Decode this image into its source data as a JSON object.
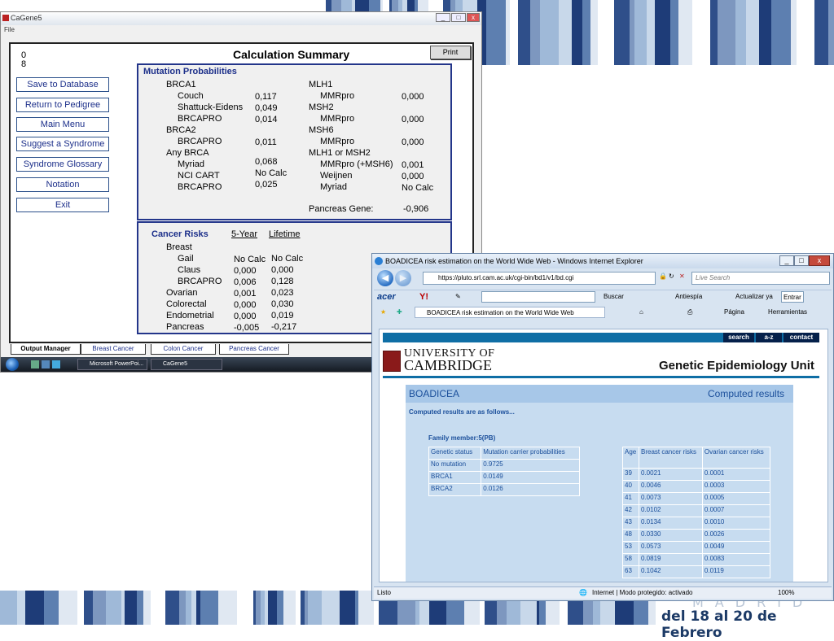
{
  "cagene": {
    "title": "CaGene5",
    "menu_file": "File",
    "code_top": "0",
    "code_bottom": "8",
    "calc_title": "Calculation Summary",
    "print_label": "Print",
    "side_buttons": [
      "Save to Database",
      "Return to Pedigree",
      "Main Menu",
      "Suggest a Syndrome",
      "Syndrome Glossary",
      "Notation",
      "Exit"
    ],
    "mutation": {
      "header": "Mutation Probabilities",
      "brca1": "BRCA1",
      "couch": "Couch",
      "couch_v": "0,117",
      "shattuck": "Shattuck-Eidens",
      "shattuck_v": "0,049",
      "brcapro1": "BRCAPRO",
      "brcapro1_v": "0,014",
      "brca2": "BRCA2",
      "brcapro2": "BRCAPRO",
      "brcapro2_v": "0,011",
      "anybrca": "Any BRCA",
      "myriad": "Myriad",
      "myriad_v": "0,068",
      "ncicart": "NCI CART",
      "ncicart_v": "No Calc",
      "brcapro3": "BRCAPRO",
      "brcapro3_v": "0,025",
      "mlh1": "MLH1",
      "mmr1": "MMRpro",
      "mmr1_v": "0,000",
      "msh2": "MSH2",
      "mmr2": "MMRpro",
      "mmr2_v": "0,000",
      "msh6": "MSH6",
      "mmr3": "MMRpro",
      "mmr3_v": "0,000",
      "mlh1msh2": "MLH1 or MSH2",
      "mmr4": "MMRpro (+MSH6)",
      "mmr4_v": "0,001",
      "weijnen": "Weijnen",
      "weijnen_v": "0,000",
      "myriad2": "Myriad",
      "myriad2_v": "No Calc",
      "pancreas_gene": "Pancreas Gene:",
      "pancreas_gene_v": "-0,906"
    },
    "cancer": {
      "header": "Cancer Risks",
      "col5": "5-Year",
      "collife": "Lifetime",
      "breast": "Breast",
      "rows": [
        {
          "label": "Gail",
          "v5": "No Calc",
          "vl": "No Calc"
        },
        {
          "label": "Claus",
          "v5": "0,000",
          "vl": "0,000"
        },
        {
          "label": "BRCAPRO",
          "v5": "0,006",
          "vl": "0,128"
        },
        {
          "label": "Ovarian",
          "v5": "0,001",
          "vl": "0,023"
        },
        {
          "label": "Colorectal",
          "v5": "0,000",
          "vl": "0,030"
        },
        {
          "label": "Endometrial",
          "v5": "0,000",
          "vl": "0,019"
        },
        {
          "label": "Pancreas",
          "v5": "-0,005",
          "vl": "-0,217"
        }
      ]
    },
    "tabs": [
      "Output Manager",
      "Breast Cancer",
      "Colon Cancer",
      "Pancreas Cancer"
    ],
    "taskbar": {
      "ppt": "Microsoft PowerPoi...",
      "cagene": "CaGene5"
    }
  },
  "ie": {
    "title": "BOADICEA risk estimation on the World Wide Web - Windows Internet Explorer",
    "url": "https://pluto.srl.cam.ac.uk/cgi-bin/bd1/v1/bd.cgi",
    "search_placeholder": "Live Search",
    "toolbar": {
      "acer": "acer",
      "yahoo": "Y!",
      "buscar": "Buscar",
      "antiespia": "Antiespía",
      "actualizar": "Actualizar ya",
      "entrar": "Entrar"
    },
    "tab_label": "BOADICEA risk estimation on the World Wide Web",
    "cmd": {
      "pagina": "Página",
      "herramientas": "Herramientas"
    },
    "nav": {
      "search": "search",
      "az": "a-z",
      "contact": "contact"
    },
    "uni_line1": "UNIVERSITY OF",
    "uni_line2": "CAMBRIDGE",
    "unit": "Genetic Epidemiology Unit",
    "boadicea": "BOADICEA",
    "computed": "Computed results",
    "intro": "Computed results are as follows...",
    "family": "Family member:5(PB)",
    "mut_table": {
      "headers": [
        "Genetic status",
        "Mutation carrier probabilities"
      ],
      "rows": [
        [
          "No mutation",
          "0.9725"
        ],
        [
          "BRCA1",
          "0.0149"
        ],
        [
          "BRCA2",
          "0.0126"
        ]
      ]
    },
    "risk_table": {
      "headers": [
        "Age",
        "Breast cancer risks",
        "Ovarian cancer risks"
      ],
      "rows": [
        [
          "39",
          "0.0021",
          "0.0001"
        ],
        [
          "40",
          "0.0046",
          "0.0003"
        ],
        [
          "41",
          "0.0073",
          "0.0005"
        ],
        [
          "42",
          "0.0102",
          "0.0007"
        ],
        [
          "43",
          "0.0134",
          "0.0010"
        ],
        [
          "48",
          "0.0330",
          "0.0026"
        ],
        [
          "53",
          "0.0573",
          "0.0049"
        ],
        [
          "58",
          "0.0819",
          "0.0083"
        ],
        [
          "63",
          "0.1042",
          "0.0119"
        ]
      ]
    },
    "status_left": "Listo",
    "status_zone": "Internet | Modo protegido: activado",
    "zoom": "100%"
  },
  "banner": {
    "city": "MADRID",
    "dates": "del 18 al 20 de Febrero"
  },
  "colors": {
    "navy": "#1c2f8a",
    "cam_blue": "#0f6ea5",
    "panel_blue": "#c7dcf0"
  }
}
